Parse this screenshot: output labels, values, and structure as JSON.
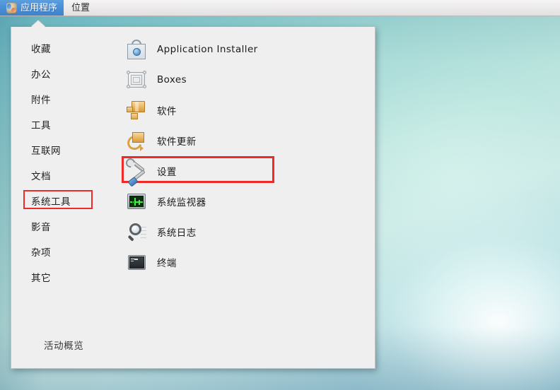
{
  "top_panel": {
    "logo_icon": "gnome-foot-icon",
    "applications_label": "应用程序",
    "places_label": "位置"
  },
  "app_menu": {
    "categories": [
      {
        "label": "收藏",
        "highlighted": false
      },
      {
        "label": "办公",
        "highlighted": false
      },
      {
        "label": "附件",
        "highlighted": false
      },
      {
        "label": "工具",
        "highlighted": false
      },
      {
        "label": "互联网",
        "highlighted": false
      },
      {
        "label": "文档",
        "highlighted": false
      },
      {
        "label": "系统工具",
        "highlighted": true
      },
      {
        "label": "影音",
        "highlighted": false
      },
      {
        "label": "杂项",
        "highlighted": false
      },
      {
        "label": "其它",
        "highlighted": false
      }
    ],
    "applications": [
      {
        "label": "Application Installer",
        "icon": "application-installer-icon",
        "highlighted": false
      },
      {
        "label": "Boxes",
        "icon": "boxes-icon",
        "highlighted": false
      },
      {
        "label": "软件",
        "icon": "software-package-icon",
        "highlighted": false
      },
      {
        "label": "软件更新",
        "icon": "software-update-icon",
        "highlighted": false
      },
      {
        "label": "设置",
        "icon": "settings-tools-icon",
        "highlighted": true
      },
      {
        "label": "系统监视器",
        "icon": "system-monitor-icon",
        "highlighted": false
      },
      {
        "label": "系统日志",
        "icon": "system-log-icon",
        "highlighted": false
      },
      {
        "label": "终端",
        "icon": "terminal-icon",
        "highlighted": false
      }
    ],
    "footer_label": "活动概览"
  },
  "colors": {
    "highlight_box": "#ee2b26",
    "panel_active_bg": "#4a8ed6",
    "menu_bg": "#efefef",
    "desktop_primary": "#a4d8d4"
  }
}
